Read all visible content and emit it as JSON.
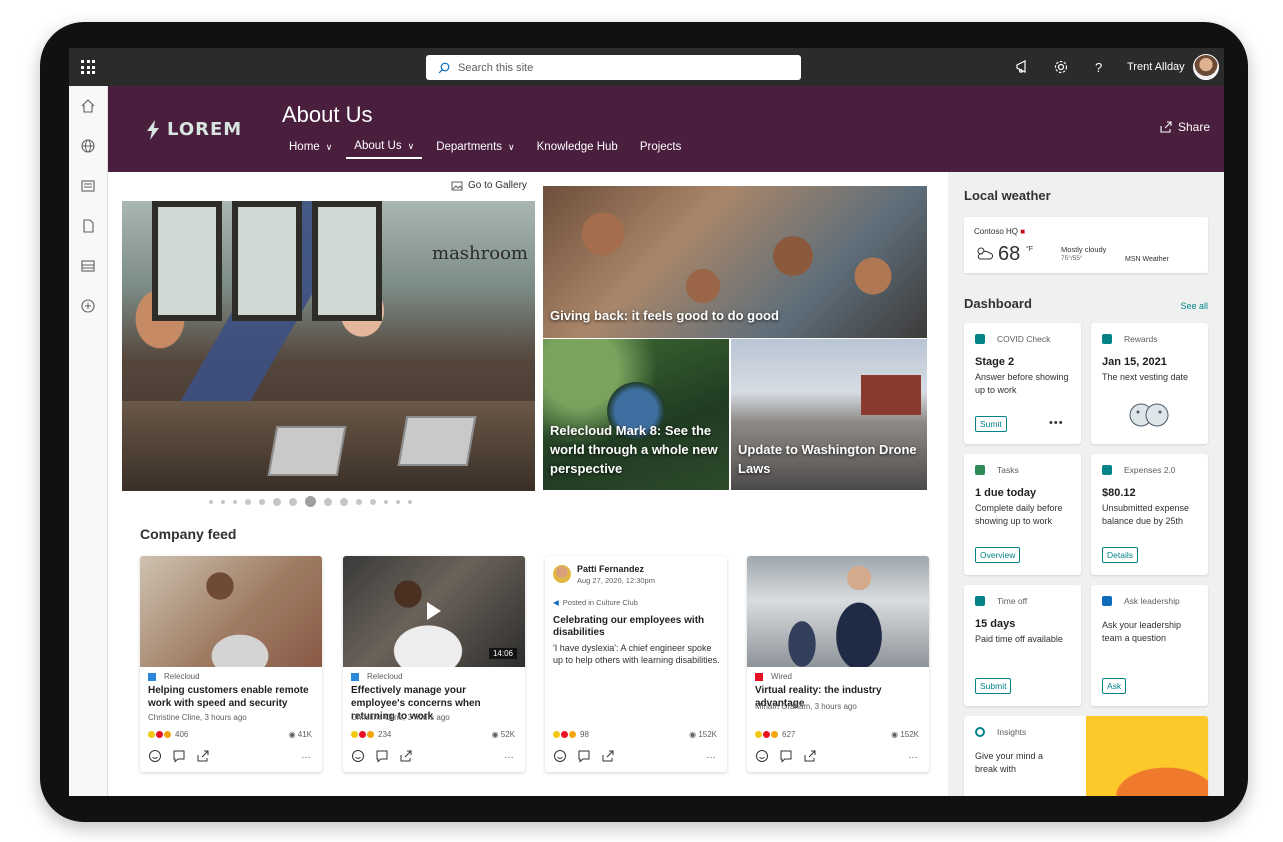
{
  "suitebar": {
    "search_placeholder": "Search this site",
    "user_name": "Trent Allday"
  },
  "header": {
    "logo_text": "LOREM",
    "site_title": "About Us",
    "nav": [
      {
        "label": "Home",
        "has_dropdown": true
      },
      {
        "label": "About Us",
        "has_dropdown": true,
        "active": true
      },
      {
        "label": "Departments",
        "has_dropdown": true
      },
      {
        "label": "Knowledge Hub",
        "has_dropdown": false
      },
      {
        "label": "Projects",
        "has_dropdown": false
      }
    ],
    "share_label": "Share"
  },
  "hero": {
    "goto_gallery": "Go to Gallery",
    "main_sign": "mashroom",
    "tiles": [
      {
        "caption": "Giving back: it feels good to do good"
      },
      {
        "caption": "Relecloud Mark 8: See the world through a whole new perspective"
      },
      {
        "caption": "Update to Washington Drone Laws"
      }
    ],
    "carousel_dot_count": 15,
    "carousel_active_index": 7
  },
  "feed": {
    "title": "Company feed",
    "cards": [
      {
        "source": "Relecloud",
        "title": "Helping customers enable remote work with speed and security",
        "meta": "Christine Cline, 3 hours ago",
        "reactions": "406",
        "views": "41K"
      },
      {
        "source": "Relecloud",
        "title": "Effectively manage your employee's concerns when returning to work",
        "meta": "Christine Cline, 3 hours ago",
        "reactions": "234",
        "views": "52K",
        "duration": "14:06"
      },
      {
        "author": "Patti Fernandez",
        "date": "Aug 27, 2020, 12:30pm",
        "category": "Posted in Culture Club",
        "title": "Celebrating our employees with disabilities",
        "body": "'I have dyslexia': A chief engineer spoke up to help others with learning disabilities.",
        "reactions": "98",
        "views": "152K"
      },
      {
        "source": "Wired",
        "title": "Virtual reality: the industry advantage",
        "meta": "Miriam Graham, 3 hours ago",
        "reactions": "627",
        "views": "152K"
      }
    ]
  },
  "sidebar": {
    "weather_title": "Local weather",
    "weather": {
      "location": "Contoso HQ",
      "temp": "68",
      "unit": "°F",
      "condition": "Mostly cloudy",
      "range": "75°/55°",
      "provider": "MSN Weather"
    },
    "dashboard_title": "Dashboard",
    "see_all": "See all",
    "cards": [
      {
        "label": "COVID Check",
        "headline": "Stage 2",
        "desc": "Answer before showing up to work",
        "button": "Sumit",
        "color": "#038387"
      },
      {
        "label": "Rewards",
        "headline": "Jan 15, 2021",
        "desc": "The next vesting date",
        "color": "#038387"
      },
      {
        "label": "Tasks",
        "headline": "1 due today",
        "desc": "Complete daily before showing up to work",
        "button": "Overview",
        "color": "#2e8b57"
      },
      {
        "label": "Expenses 2.0",
        "headline": "$80.12",
        "desc": "Unsubmitted expense balance due by 25th",
        "button": "Details",
        "color": "#038387"
      },
      {
        "label": "Time off",
        "headline": "15 days",
        "desc": "Paid time off available",
        "button": "Submit",
        "color": "#038387"
      },
      {
        "label": "Ask leadership",
        "headline": "",
        "desc": "Ask your leadership team a question",
        "button": "Ask",
        "color": "#0f6cbd"
      },
      {
        "label": "Insights",
        "headline": "",
        "desc": "Give your mind a break with",
        "color": "#038387"
      }
    ]
  }
}
